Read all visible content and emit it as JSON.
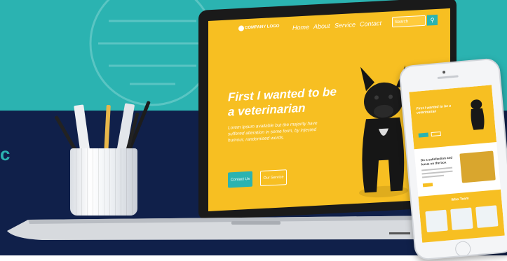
{
  "side_letter": "c",
  "site": {
    "logo_text": "COMPANY LOGO",
    "nav": [
      {
        "label": "Home"
      },
      {
        "label": "About"
      },
      {
        "label": "Service"
      },
      {
        "label": "Contact"
      }
    ],
    "search_placeholder": "Search",
    "search_icon": "search-icon",
    "hero_title_line1": "First I wanted to be",
    "hero_title_line2": "a veterinarian",
    "hero_text_line1": "Lorem Ipsum available but the majority have",
    "hero_text_line2": "suffered alteration in some form, by injected",
    "hero_text_line3": "humour, randomised words.",
    "contact_button": "Contact Us",
    "service_button": "Our Service"
  },
  "phone": {
    "hero_title": "First I wanted to be a veterinarian",
    "section_title": "Do a satisfaction and focus on the box",
    "footer_title": "Who Team"
  },
  "colors": {
    "teal": "#2bb3b1",
    "navy": "#10204a",
    "yellow": "#f7bf22",
    "white": "#ffffff"
  }
}
